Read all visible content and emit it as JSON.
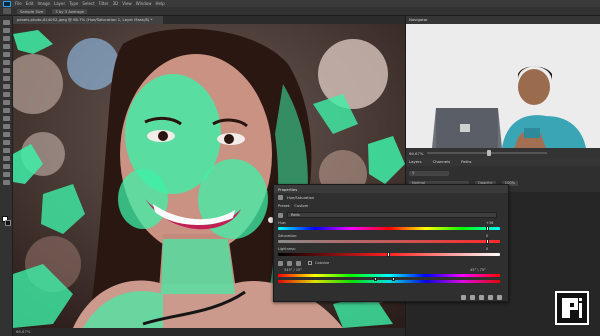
{
  "menubar": {
    "items": [
      "File",
      "Edit",
      "Image",
      "Layer",
      "Type",
      "Select",
      "Filter",
      "3D",
      "View",
      "Window",
      "Help"
    ]
  },
  "options": {
    "sample_size": "Sample Size",
    "sample_value": "3 by 3 Average"
  },
  "document": {
    "tab_title": "pexels-photo-814052.jpeg @ 66.7% (Hue/Saturation 1, Layer Mask/8) *",
    "status": "66.67%"
  },
  "navigator": {
    "tab": "Navigator",
    "zoom": "66.67%"
  },
  "layers": {
    "tabs": [
      "Layers",
      "Channels",
      "Paths"
    ],
    "blend_mode": "Normal",
    "opacity_label": "Opacity:",
    "opacity_value": "100%"
  },
  "properties": {
    "title": "Properties",
    "adjustment": "Hue/Saturation",
    "preset_label": "Preset:",
    "preset_value": "Custom",
    "channel_value": "Reds",
    "hue_label": "Hue:",
    "hue_value": "+36",
    "saturation_label": "Saturation:",
    "saturation_value": "0",
    "lightness_label": "Lightness:",
    "lightness_value": "0",
    "colorize_label": "Colorize",
    "range_left": "345° / 15°",
    "range_right": "45° \\ 75°"
  },
  "colors": {
    "accent": "#31a8ff",
    "mask_green": "#3ef0a8"
  }
}
